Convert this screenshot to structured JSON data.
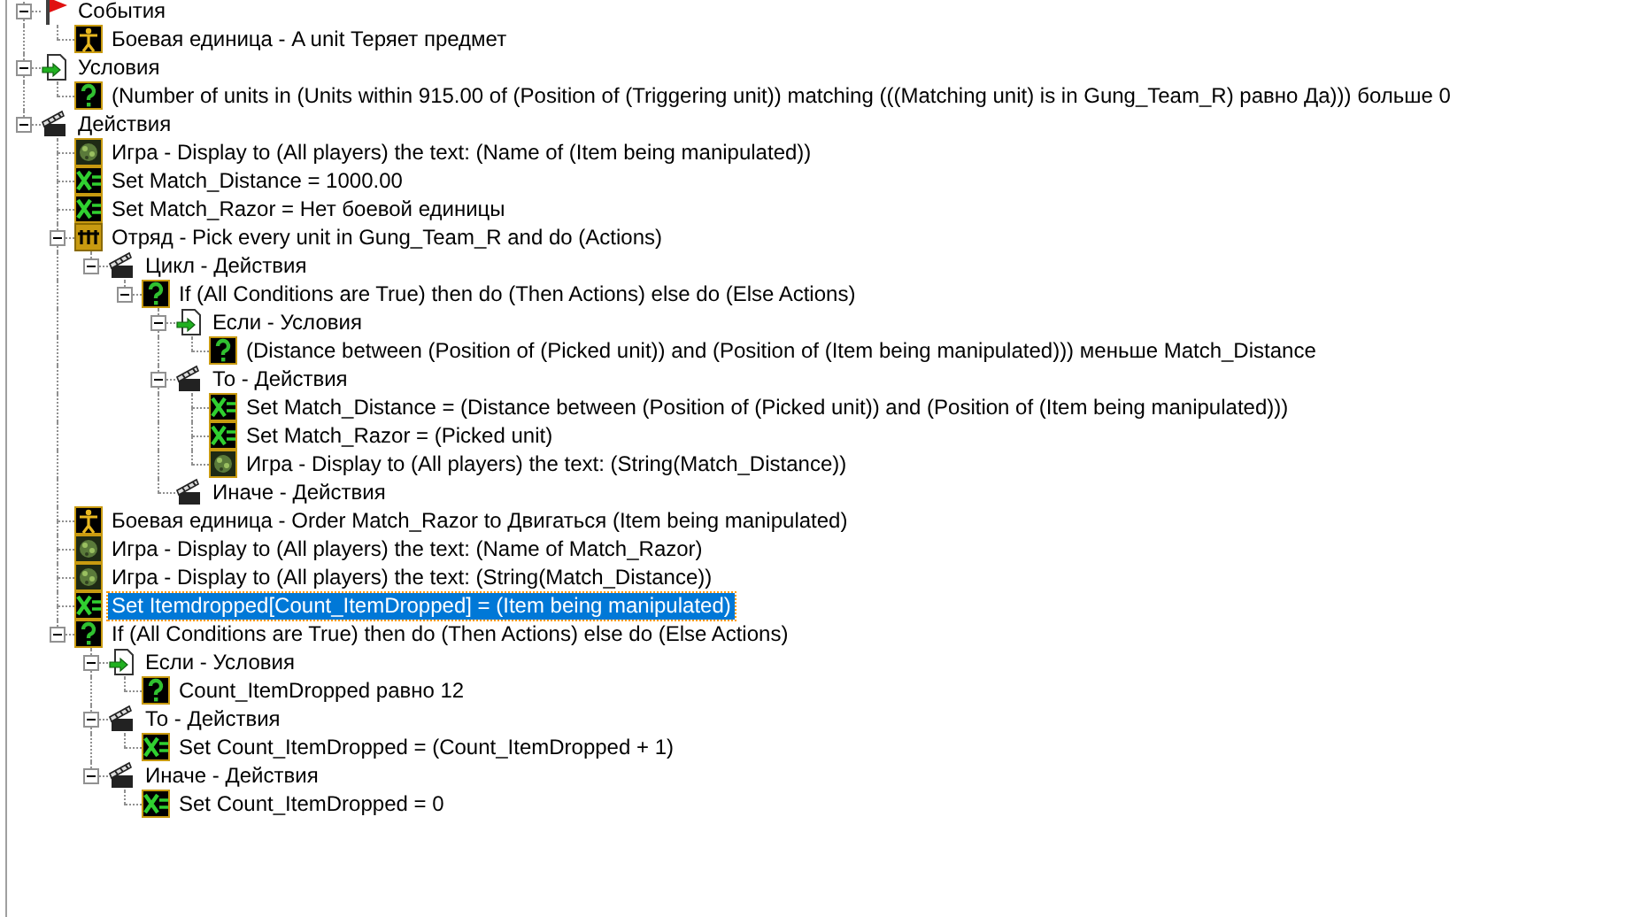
{
  "tree": [
    {
      "kind": "event",
      "text": "События",
      "expanded": true,
      "selected": false,
      "children": [
        {
          "kind": "unit",
          "text": "Боевая единица - A unit Теряет предмет",
          "selected": false
        }
      ]
    },
    {
      "kind": "conditions",
      "text": "Условия",
      "expanded": true,
      "selected": false,
      "children": [
        {
          "kind": "condition",
          "text": "(Number of units in (Units within 915.00 of (Position of (Triggering unit)) matching (((Matching unit) is in Gung_Team_R) равно Да))) больше 0",
          "selected": false
        }
      ]
    },
    {
      "kind": "actions",
      "text": "Действия",
      "expanded": true,
      "selected": false,
      "children": [
        {
          "kind": "game",
          "text": "Игра - Display to (All players) the text: (Name of (Item being manipulated))",
          "selected": false
        },
        {
          "kind": "set",
          "text": "Set Match_Distance = 1000.00",
          "selected": false
        },
        {
          "kind": "set",
          "text": "Set Match_Razor = Нет боевой единицы",
          "selected": false
        },
        {
          "kind": "group",
          "text": "Отряд - Pick every unit in Gung_Team_R and do (Actions)",
          "expanded": true,
          "selected": false,
          "children": [
            {
              "kind": "actions",
              "text": "Цикл - Действия",
              "expanded": true,
              "selected": false,
              "children": [
                {
                  "kind": "condition",
                  "text": "If (All Conditions are True) then do (Then Actions) else do (Else Actions)",
                  "expanded": true,
                  "selected": false,
                  "children": [
                    {
                      "kind": "conditions",
                      "text": "Если - Условия",
                      "expanded": true,
                      "selected": false,
                      "children": [
                        {
                          "kind": "condition",
                          "text": "(Distance between (Position of (Picked unit)) and (Position of (Item being manipulated))) меньше Match_Distance",
                          "selected": false
                        }
                      ]
                    },
                    {
                      "kind": "actions",
                      "text": "То - Действия",
                      "expanded": true,
                      "selected": false,
                      "children": [
                        {
                          "kind": "set",
                          "text": "Set Match_Distance = (Distance between (Position of (Picked unit)) and (Position of (Item being manipulated)))",
                          "selected": false
                        },
                        {
                          "kind": "set",
                          "text": "Set Match_Razor = (Picked unit)",
                          "selected": false
                        },
                        {
                          "kind": "game",
                          "text": "Игра - Display to (All players) the text: (String(Match_Distance))",
                          "selected": false
                        }
                      ]
                    },
                    {
                      "kind": "actions",
                      "text": "Иначе - Действия",
                      "selected": false
                    }
                  ]
                }
              ]
            }
          ]
        },
        {
          "kind": "unit",
          "text": "Боевая единица - Order Match_Razor to Двигаться (Item being manipulated)",
          "selected": false
        },
        {
          "kind": "game",
          "text": "Игра - Display to (All players) the text: (Name of Match_Razor)",
          "selected": false
        },
        {
          "kind": "game",
          "text": "Игра - Display to (All players) the text: (String(Match_Distance))",
          "selected": false
        },
        {
          "kind": "set",
          "text": "Set Itemdropped[Count_ItemDropped] = (Item being manipulated)",
          "selected": true
        },
        {
          "kind": "condition",
          "text": "If (All Conditions are True) then do (Then Actions) else do (Else Actions)",
          "expanded": true,
          "selected": false,
          "children": [
            {
              "kind": "conditions",
              "text": "Если - Условия",
              "expanded": true,
              "selected": false,
              "children": [
                {
                  "kind": "condition",
                  "text": "Count_ItemDropped равно 12",
                  "selected": false
                }
              ]
            },
            {
              "kind": "actions",
              "text": "То - Действия",
              "expanded": true,
              "selected": false,
              "children": [
                {
                  "kind": "set",
                  "text": "Set Count_ItemDropped = (Count_ItemDropped + 1)",
                  "selected": false
                }
              ]
            },
            {
              "kind": "actions",
              "text": "Иначе - Действия",
              "expanded": true,
              "selected": false,
              "children": [
                {
                  "kind": "set",
                  "text": "Set Count_ItemDropped = 0",
                  "selected": false
                }
              ]
            }
          ]
        }
      ]
    }
  ]
}
